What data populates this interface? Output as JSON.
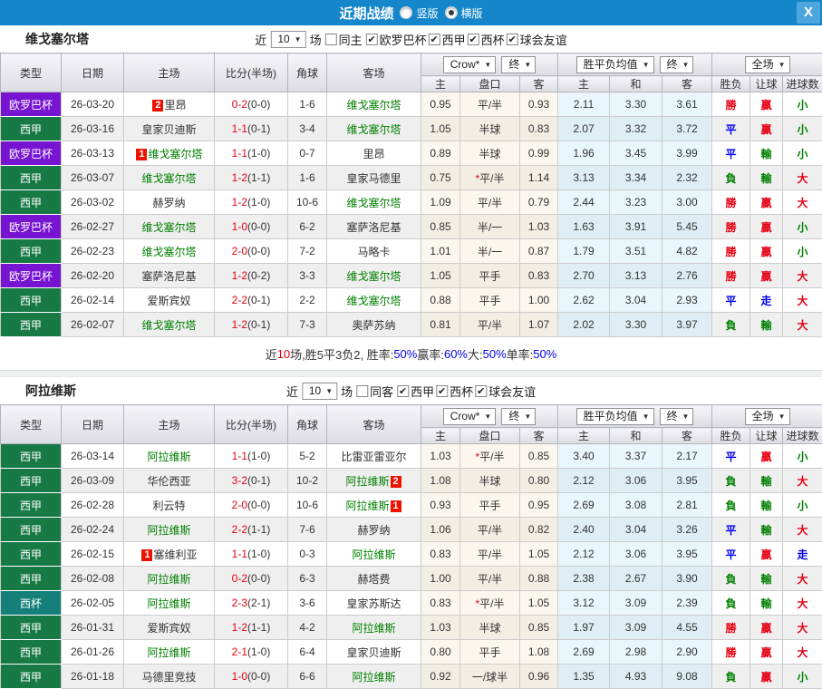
{
  "titlebar": {
    "title": "近期战绩",
    "radio_vertical": "竖版",
    "radio_horizontal": "横版"
  },
  "icons": {
    "close": "X",
    "arrow": "▼",
    "check": "✔"
  },
  "header": {
    "type": "类型",
    "date": "日期",
    "home": "主场",
    "score": "比分(半场)",
    "corner": "角球",
    "away": "客场",
    "h": "主",
    "line": "盘口",
    "a": "客",
    "avg_h": "主",
    "avg_d": "和",
    "avg_a": "客",
    "wdl": "胜负",
    "let": "让球",
    "goal": "进球数",
    "sel_crow": "Crow*",
    "sel_final": "终",
    "sel_avg": "胜平负均值",
    "sel_scope": "全场"
  },
  "filter_labels": {
    "recent": "近",
    "count": "10",
    "games": "场"
  },
  "league_colors": {
    "欧罗巴杯": "#7714d2",
    "西甲": "#177a45",
    "西杯": "#15807a"
  },
  "result_colors": {
    "r": "#e60012",
    "g": "#008000",
    "b": "#0000ee",
    "d": "#333333"
  },
  "char_colors": {
    "勝": "r",
    "贏": "r",
    "大": "r",
    "平": "b",
    "走": "b",
    "負": "g",
    "輸": "g",
    "小": "g"
  },
  "sections": [
    {
      "team": "维戈塞尔塔",
      "same": "同主",
      "leagues": [
        "欧罗巴杯",
        "西甲",
        "西杯",
        "球会友谊"
      ],
      "rows": [
        {
          "lg": "欧罗巴杯",
          "dt": "26-03-20",
          "h": {
            "n": "里昂",
            "c": "2",
            "cp": "b"
          },
          "sc": "0-2",
          "ht": "(0-0)",
          "cn": "1-6",
          "a": {
            "n": "维戈塞尔塔",
            "f": 1
          },
          "o": [
            "0.95",
            "平/半",
            "0.93"
          ],
          "v": [
            "2.11",
            "3.30",
            "3.61"
          ],
          "r": [
            "勝",
            "贏",
            "小"
          ]
        },
        {
          "lg": "西甲",
          "dt": "26-03-16",
          "h": {
            "n": "皇家贝迪斯"
          },
          "sc": "1-1",
          "ht": "(0-1)",
          "cn": "3-4",
          "a": {
            "n": "维戈塞尔塔",
            "f": 1
          },
          "o": [
            "1.05",
            "半球",
            "0.83"
          ],
          "v": [
            "2.07",
            "3.32",
            "3.72"
          ],
          "r": [
            "平",
            "贏",
            "小"
          ]
        },
        {
          "lg": "欧罗巴杯",
          "dt": "26-03-13",
          "h": {
            "n": "维戈塞尔塔",
            "f": 1,
            "c": "1",
            "cp": "b"
          },
          "sc": "1-1",
          "ht": "(1-0)",
          "cn": "0-7",
          "a": {
            "n": "里昂"
          },
          "o": [
            "0.89",
            "半球",
            "0.99"
          ],
          "v": [
            "1.96",
            "3.45",
            "3.99"
          ],
          "r": [
            "平",
            "輸",
            "小"
          ]
        },
        {
          "lg": "西甲",
          "dt": "26-03-07",
          "h": {
            "n": "维戈塞尔塔",
            "f": 1
          },
          "sc": "1-2",
          "ht": "(1-1)",
          "cn": "1-6",
          "a": {
            "n": "皇家马德里"
          },
          "o": [
            "0.75",
            "*平/半",
            "1.14"
          ],
          "v": [
            "3.13",
            "3.34",
            "2.32"
          ],
          "r": [
            "負",
            "輸",
            "大"
          ]
        },
        {
          "lg": "西甲",
          "dt": "26-03-02",
          "h": {
            "n": "赫罗纳"
          },
          "sc": "1-2",
          "ht": "(1-0)",
          "cn": "10-6",
          "a": {
            "n": "维戈塞尔塔",
            "f": 1
          },
          "o": [
            "1.09",
            "平/半",
            "0.79"
          ],
          "v": [
            "2.44",
            "3.23",
            "3.00"
          ],
          "r": [
            "勝",
            "贏",
            "大"
          ]
        },
        {
          "lg": "欧罗巴杯",
          "dt": "26-02-27",
          "h": {
            "n": "维戈塞尔塔",
            "f": 1
          },
          "sc": "1-0",
          "ht": "(0-0)",
          "cn": "6-2",
          "a": {
            "n": "塞萨洛尼基"
          },
          "o": [
            "0.85",
            "半/一",
            "1.03"
          ],
          "v": [
            "1.63",
            "3.91",
            "5.45"
          ],
          "r": [
            "勝",
            "贏",
            "小"
          ]
        },
        {
          "lg": "西甲",
          "dt": "26-02-23",
          "h": {
            "n": "维戈塞尔塔",
            "f": 1
          },
          "sc": "2-0",
          "ht": "(0-0)",
          "cn": "7-2",
          "a": {
            "n": "马略卡"
          },
          "o": [
            "1.01",
            "半/一",
            "0.87"
          ],
          "v": [
            "1.79",
            "3.51",
            "4.82"
          ],
          "r": [
            "勝",
            "贏",
            "小"
          ]
        },
        {
          "lg": "欧罗巴杯",
          "dt": "26-02-20",
          "h": {
            "n": "塞萨洛尼基"
          },
          "sc": "1-2",
          "ht": "(0-2)",
          "cn": "3-3",
          "a": {
            "n": "维戈塞尔塔",
            "f": 1
          },
          "o": [
            "1.05",
            "平手",
            "0.83"
          ],
          "v": [
            "2.70",
            "3.13",
            "2.76"
          ],
          "r": [
            "勝",
            "贏",
            "大"
          ]
        },
        {
          "lg": "西甲",
          "dt": "26-02-14",
          "h": {
            "n": "爱斯宾奴"
          },
          "sc": "2-2",
          "ht": "(0-1)",
          "cn": "2-2",
          "a": {
            "n": "维戈塞尔塔",
            "f": 1
          },
          "o": [
            "0.88",
            "平手",
            "1.00"
          ],
          "v": [
            "2.62",
            "3.04",
            "2.93"
          ],
          "r": [
            "平",
            "走",
            "大"
          ]
        },
        {
          "lg": "西甲",
          "dt": "26-02-07",
          "h": {
            "n": "维戈塞尔塔",
            "f": 1
          },
          "sc": "1-2",
          "ht": "(0-1)",
          "cn": "7-3",
          "a": {
            "n": "奥萨苏纳"
          },
          "o": [
            "0.81",
            "平/半",
            "1.07"
          ],
          "v": [
            "2.02",
            "3.30",
            "3.97"
          ],
          "r": [
            "負",
            "輸",
            "大"
          ]
        }
      ],
      "summary": [
        [
          "近",
          "d"
        ],
        [
          "10",
          "r"
        ],
        [
          "场,胜5平3负2, 胜率:",
          "d"
        ],
        [
          "50%",
          "b"
        ],
        [
          " 赢率:",
          "d"
        ],
        [
          "60%",
          "b"
        ],
        [
          " 大:",
          "d"
        ],
        [
          "50%",
          "b"
        ],
        [
          " 单率:",
          "d"
        ],
        [
          "50%",
          "b"
        ]
      ]
    },
    {
      "team": "阿拉维斯",
      "same": "同客",
      "leagues": [
        "西甲",
        "西杯",
        "球会友谊"
      ],
      "rows": [
        {
          "lg": "西甲",
          "dt": "26-03-14",
          "h": {
            "n": "阿拉维斯",
            "f": 1
          },
          "sc": "1-1",
          "ht": "(1-0)",
          "cn": "5-2",
          "a": {
            "n": "比雷亚雷亚尔"
          },
          "o": [
            "1.03",
            "*平/半",
            "0.85"
          ],
          "v": [
            "3.40",
            "3.37",
            "2.17"
          ],
          "r": [
            "平",
            "贏",
            "小"
          ]
        },
        {
          "lg": "西甲",
          "dt": "26-03-09",
          "h": {
            "n": "华伦西亚"
          },
          "sc": "3-2",
          "ht": "(0-1)",
          "cn": "10-2",
          "a": {
            "n": "阿拉维斯",
            "f": 1,
            "c": "2",
            "cp": "a"
          },
          "o": [
            "1.08",
            "半球",
            "0.80"
          ],
          "v": [
            "2.12",
            "3.06",
            "3.95"
          ],
          "r": [
            "負",
            "輸",
            "大"
          ]
        },
        {
          "lg": "西甲",
          "dt": "26-02-28",
          "h": {
            "n": "利云特"
          },
          "sc": "2-0",
          "ht": "(0-0)",
          "cn": "10-6",
          "a": {
            "n": "阿拉维斯",
            "f": 1,
            "c": "1",
            "cp": "a"
          },
          "o": [
            "0.93",
            "平手",
            "0.95"
          ],
          "v": [
            "2.69",
            "3.08",
            "2.81"
          ],
          "r": [
            "負",
            "輸",
            "小"
          ]
        },
        {
          "lg": "西甲",
          "dt": "26-02-24",
          "h": {
            "n": "阿拉维斯",
            "f": 1
          },
          "sc": "2-2",
          "ht": "(1-1)",
          "cn": "7-6",
          "a": {
            "n": "赫罗纳"
          },
          "o": [
            "1.06",
            "平/半",
            "0.82"
          ],
          "v": [
            "2.40",
            "3.04",
            "3.26"
          ],
          "r": [
            "平",
            "輸",
            "大"
          ]
        },
        {
          "lg": "西甲",
          "dt": "26-02-15",
          "h": {
            "n": "塞维利亚",
            "c": "1",
            "cp": "b"
          },
          "sc": "1-1",
          "ht": "(1-0)",
          "cn": "0-3",
          "a": {
            "n": "阿拉维斯",
            "f": 1
          },
          "o": [
            "0.83",
            "平/半",
            "1.05"
          ],
          "v": [
            "2.12",
            "3.06",
            "3.95"
          ],
          "r": [
            "平",
            "贏",
            "走"
          ]
        },
        {
          "lg": "西甲",
          "dt": "26-02-08",
          "h": {
            "n": "阿拉维斯",
            "f": 1
          },
          "sc": "0-2",
          "ht": "(0-0)",
          "cn": "6-3",
          "a": {
            "n": "赫塔费"
          },
          "o": [
            "1.00",
            "平/半",
            "0.88"
          ],
          "v": [
            "2.38",
            "2.67",
            "3.90"
          ],
          "r": [
            "負",
            "輸",
            "大"
          ]
        },
        {
          "lg": "西杯",
          "dt": "26-02-05",
          "h": {
            "n": "阿拉维斯",
            "f": 1
          },
          "sc": "2-3",
          "ht": "(2-1)",
          "cn": "3-6",
          "a": {
            "n": "皇家苏斯达"
          },
          "o": [
            "0.83",
            "*平/半",
            "1.05"
          ],
          "v": [
            "3.12",
            "3.09",
            "2.39"
          ],
          "r": [
            "負",
            "輸",
            "大"
          ]
        },
        {
          "lg": "西甲",
          "dt": "26-01-31",
          "h": {
            "n": "爱斯宾奴"
          },
          "sc": "1-2",
          "ht": "(1-1)",
          "cn": "4-2",
          "a": {
            "n": "阿拉维斯",
            "f": 1
          },
          "o": [
            "1.03",
            "半球",
            "0.85"
          ],
          "v": [
            "1.97",
            "3.09",
            "4.55"
          ],
          "r": [
            "勝",
            "贏",
            "大"
          ]
        },
        {
          "lg": "西甲",
          "dt": "26-01-26",
          "h": {
            "n": "阿拉维斯",
            "f": 1
          },
          "sc": "2-1",
          "ht": "(1-0)",
          "cn": "6-4",
          "a": {
            "n": "皇家贝迪斯"
          },
          "o": [
            "0.80",
            "平手",
            "1.08"
          ],
          "v": [
            "2.69",
            "2.98",
            "2.90"
          ],
          "r": [
            "勝",
            "贏",
            "大"
          ]
        },
        {
          "lg": "西甲",
          "dt": "26-01-18",
          "h": {
            "n": "马德里竞技"
          },
          "sc": "1-0",
          "ht": "(0-0)",
          "cn": "6-6",
          "a": {
            "n": "阿拉维斯",
            "f": 1
          },
          "o": [
            "0.92",
            "一/球半",
            "0.96"
          ],
          "v": [
            "1.35",
            "4.93",
            "9.08"
          ],
          "r": [
            "負",
            "贏",
            "小"
          ]
        }
      ]
    }
  ]
}
